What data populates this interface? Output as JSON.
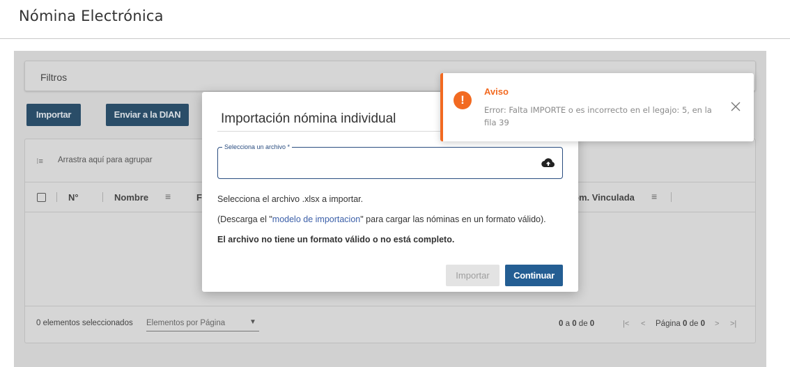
{
  "page": {
    "title": "Nómina Electrónica"
  },
  "filters": {
    "label": "Filtros"
  },
  "toolbar": {
    "import_label": "Importar",
    "send_label": "Enviar a la DIAN"
  },
  "grid": {
    "group_hint": "Arrastra aquí para agrupar",
    "columns": {
      "number": "N°",
      "name": "Nombre",
      "f": "F",
      "linked": "om. Vinculada"
    },
    "footer": {
      "selected": "0 elementos seleccionados",
      "per_page_placeholder": "Elementos por Página",
      "range_a": "0",
      "range_sep1": " a ",
      "range_b": "0",
      "range_sep2": " de ",
      "range_c": "0",
      "page_prefix": "Página ",
      "page_current": "0",
      "page_of": " de ",
      "page_total": "0"
    }
  },
  "modal": {
    "title": "Importación nómina individual",
    "file_label": "Selecciona un archivo *",
    "line1": "Selecciona el archivo .xlsx a importar.",
    "line2_pre": "(Descarga el \"",
    "line2_link": "modelo de importacion",
    "line2_post": "\" para cargar las nóminas en un formato válido).",
    "error": "El archivo no tiene un formato válido o no está completo.",
    "import_button": "Importar",
    "continue_button": "Continuar"
  },
  "toast": {
    "title": "Aviso",
    "icon": "!",
    "message": "Error: Falta IMPORTE o es incorrecto en el legajo: 5, en la fila 39"
  },
  "colors": {
    "accent": "#245e93",
    "warning": "#f26a21"
  }
}
